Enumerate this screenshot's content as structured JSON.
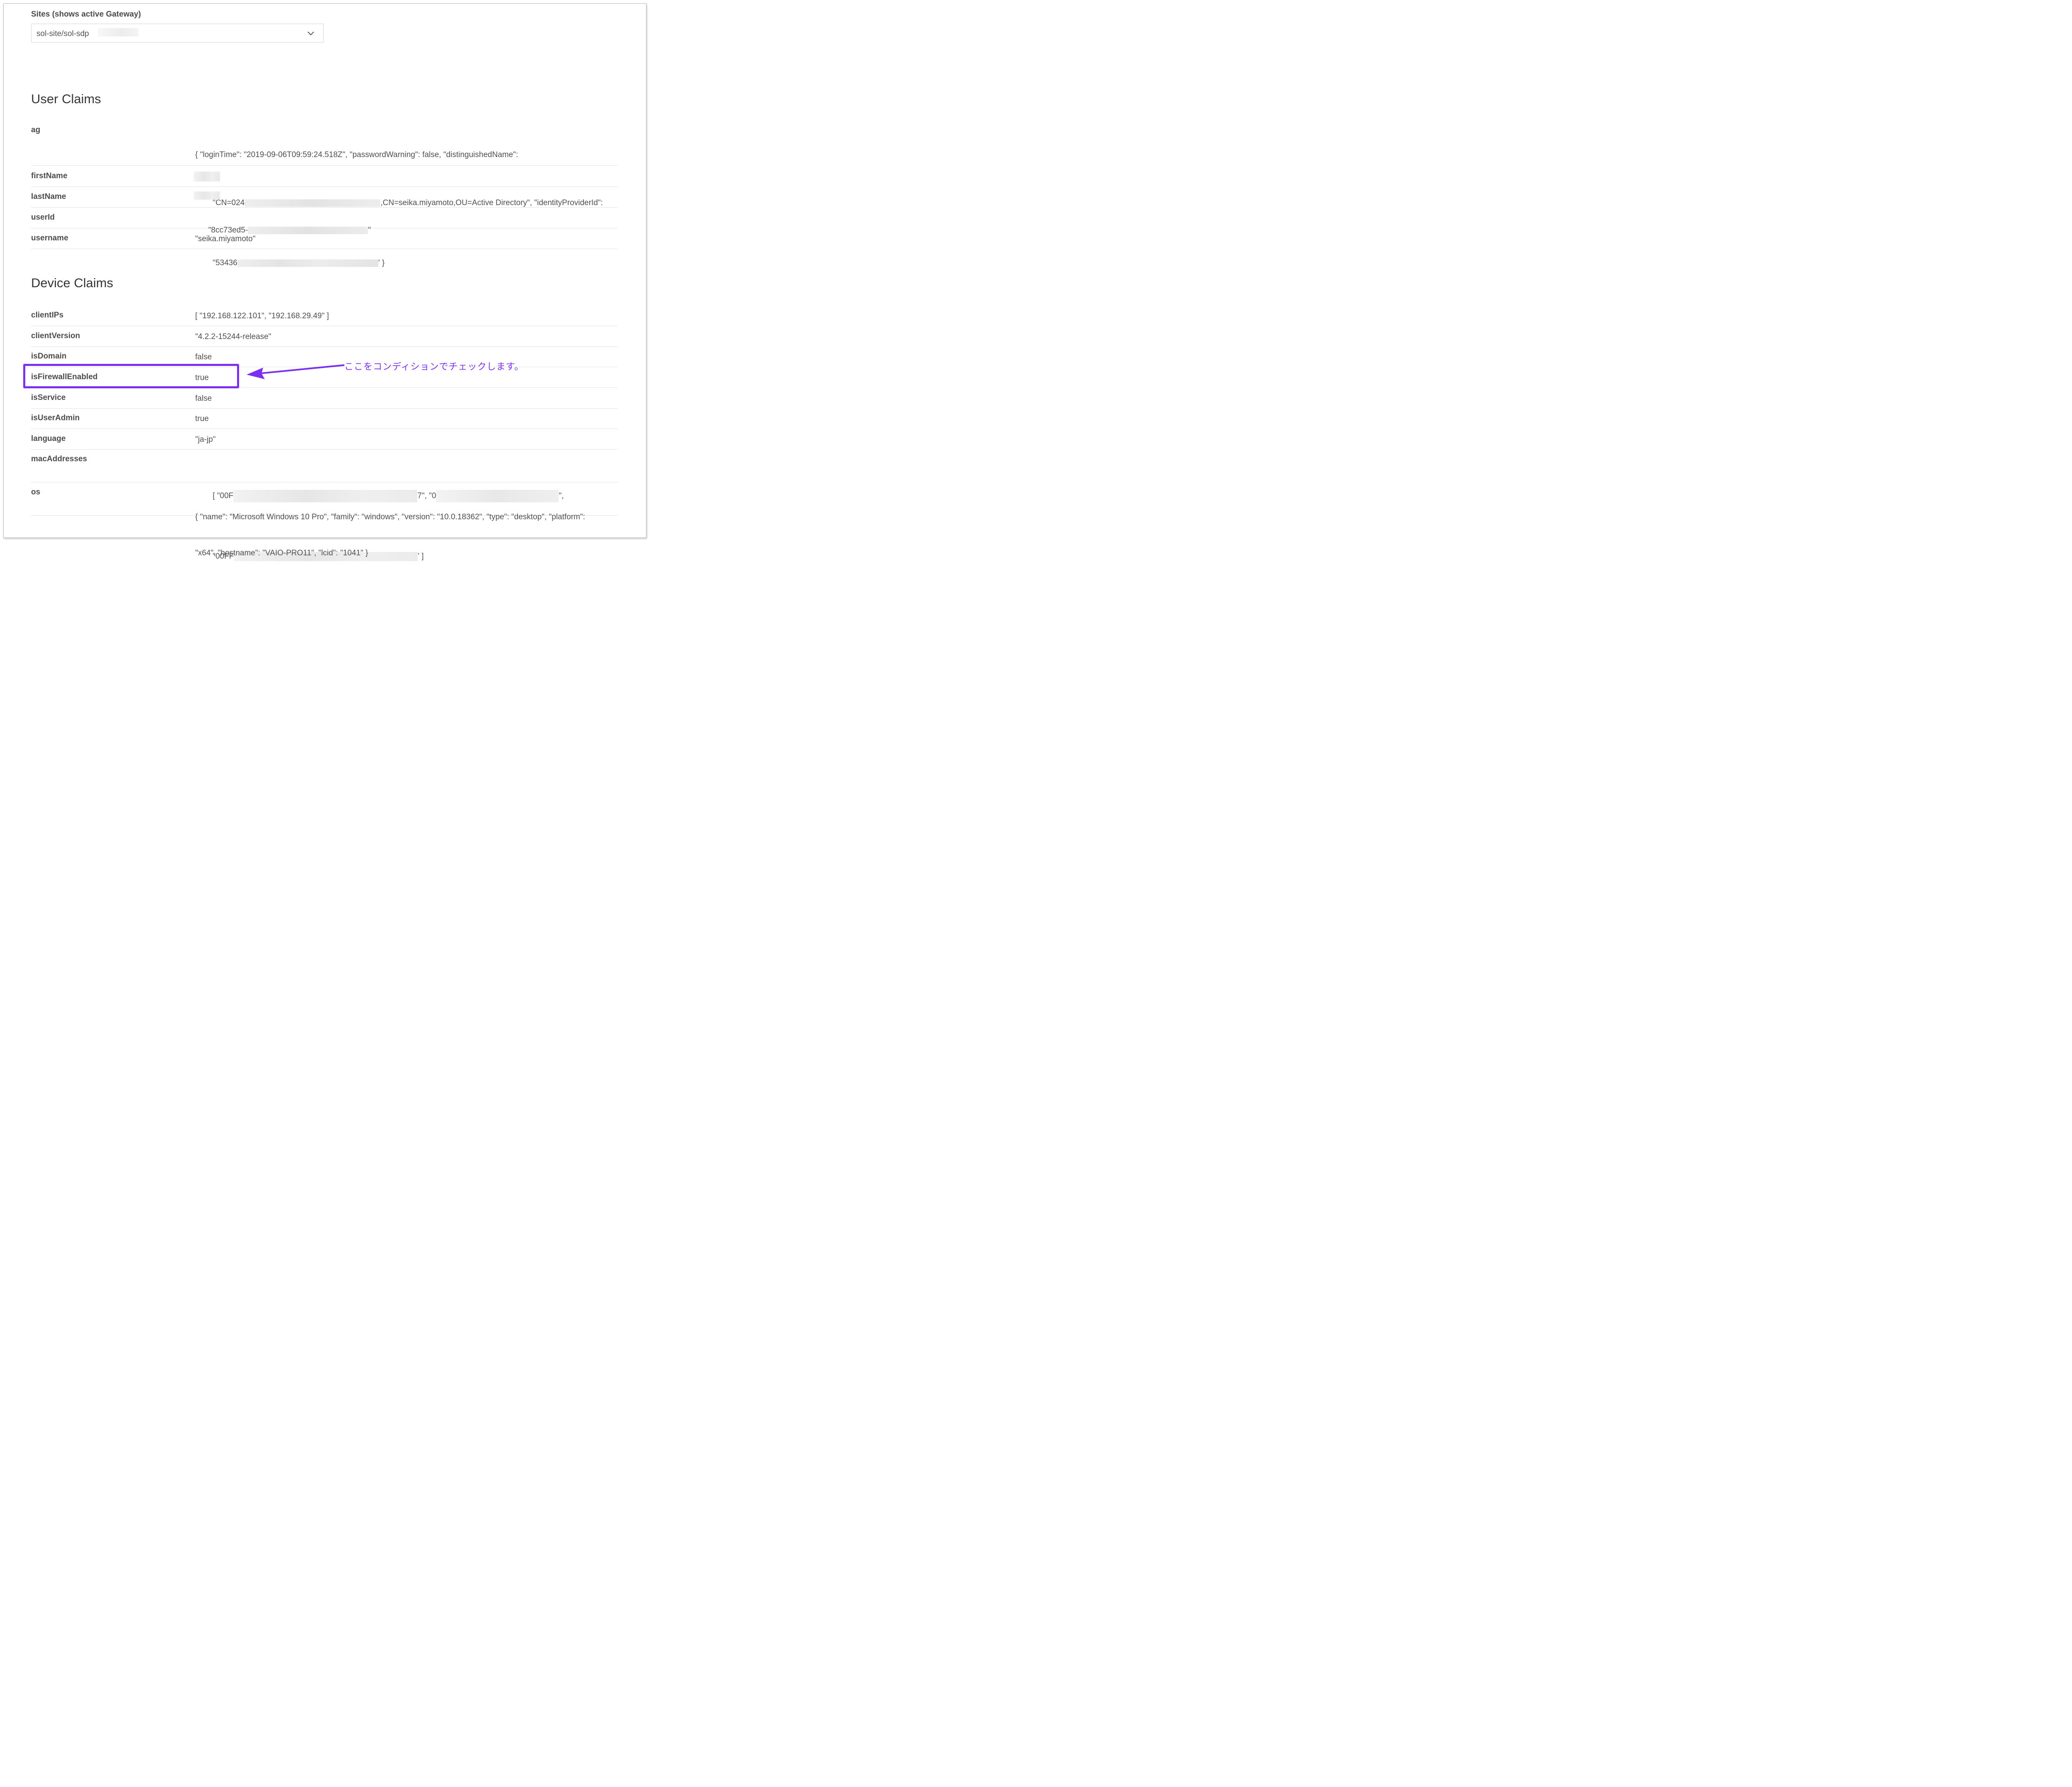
{
  "sites": {
    "label": "Sites (shows active Gateway)",
    "selected": "sol-site/sol-sdp"
  },
  "user_claims": {
    "title": "User Claims",
    "rows": [
      {
        "key": "ag",
        "line1": "{ \"loginTime\": \"2019-09-06T09:59:24.518Z\", \"passwordWarning\": false, \"distinguishedName\":",
        "line2a": "\"CN=024",
        "line2b": ",CN=seika.miyamoto,OU=Active Directory\", \"identityProviderId\":",
        "line3a": "\"53436",
        "line3b": "' }"
      },
      {
        "key": "firstName",
        "value": ""
      },
      {
        "key": "lastName",
        "value": ""
      },
      {
        "key": "userId",
        "value_a": "\"8cc73ed5-",
        "value_b": "\""
      },
      {
        "key": "username",
        "value": "\"seika.miyamoto\""
      }
    ]
  },
  "device_claims": {
    "title": "Device Claims",
    "rows": [
      {
        "key": "clientIPs",
        "value": "[ \"192.168.122.101\", \"192.168.29.49\" ]"
      },
      {
        "key": "clientVersion",
        "value": "\"4.2.2-15244-release\""
      },
      {
        "key": "isDomain",
        "value": "false"
      },
      {
        "key": "isFirewallEnabled",
        "value": "true"
      },
      {
        "key": "isService",
        "value": "false"
      },
      {
        "key": "isUserAdmin",
        "value": "true"
      },
      {
        "key": "language",
        "value": "\"ja-jp\""
      },
      {
        "key": "macAddresses",
        "line1a": "[ \"00F",
        "line1b": "7\", \"0",
        "line1c": "\",",
        "line2a": "\"00FF",
        "line2b": "' ]"
      },
      {
        "key": "os",
        "line1": "{ \"name\": \"Microsoft Windows 10 Pro\", \"family\": \"windows\", \"version\": \"10.0.18362\", \"type\": \"desktop\", \"platform\":",
        "line2": "\"x64\", \"hostname\": \"VAIO-PRO11\", \"lcid\": \"1041\" }"
      }
    ]
  },
  "annotation": {
    "text": "ここをコンディションでチェックします。",
    "color": "#7b2ff0"
  },
  "icons": {
    "dropdown": "chevron-down-icon",
    "pointer": "arrow-left-icon"
  }
}
